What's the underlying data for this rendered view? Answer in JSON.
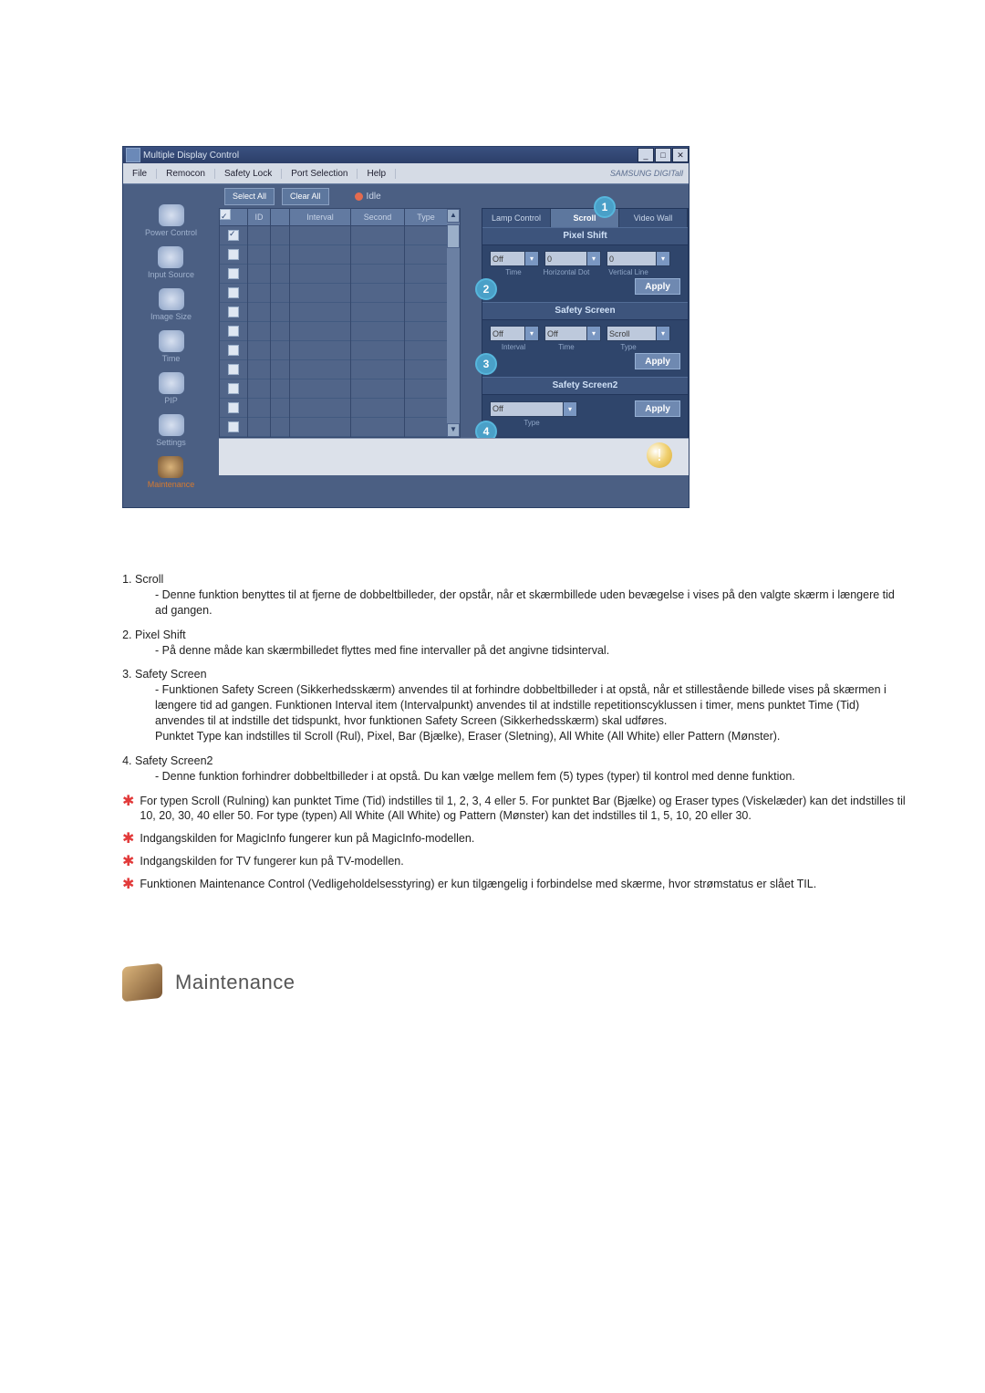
{
  "app": {
    "title": "Multiple Display Control",
    "menu": [
      "File",
      "Remocon",
      "Safety Lock",
      "Port Selection",
      "Help"
    ],
    "brand": "SAMSUNG DIGITall"
  },
  "toolbar": {
    "select_all": "Select All",
    "clear_all": "Clear All",
    "idle": "Idle"
  },
  "sidebar": {
    "items": [
      {
        "label": "Power Control"
      },
      {
        "label": "Input Source"
      },
      {
        "label": "Image Size"
      },
      {
        "label": "Time"
      },
      {
        "label": "PIP"
      },
      {
        "label": "Settings"
      },
      {
        "label": "Maintenance"
      }
    ]
  },
  "table": {
    "headers": {
      "check": "",
      "id": "ID",
      "ico": "",
      "interval": "Interval",
      "second": "Second",
      "type": "Type"
    },
    "rows": 11
  },
  "panel": {
    "tabs": {
      "lamp": "Lamp Control",
      "scroll": "Scroll",
      "video_wall": "Video Wall"
    },
    "labels": {
      "1": "1",
      "2": "2",
      "3": "3",
      "4": "4"
    },
    "pixel_shift": {
      "title": "Pixel Shift",
      "time": {
        "value": "Off",
        "label": "Time"
      },
      "hdot": {
        "value": "0",
        "label": "Horizontal Dot"
      },
      "vline": {
        "value": "0",
        "label": "Vertical Line"
      },
      "apply": "Apply"
    },
    "safety_screen": {
      "title": "Safety Screen",
      "interval": {
        "value": "Off",
        "label": "Interval"
      },
      "time": {
        "value": "Off",
        "label": "Time"
      },
      "type": {
        "value": "Scroll",
        "label": "Type"
      },
      "apply": "Apply"
    },
    "safety_screen2": {
      "title": "Safety Screen2",
      "type": {
        "value": "Off",
        "label": "Type"
      },
      "apply": "Apply"
    }
  },
  "content": {
    "items": [
      {
        "title": "Scroll",
        "body": "- Denne funktion benyttes til at fjerne de dobbeltbilleder, der opstår, når et skærmbillede uden bevægelse i vises på den valgte skærm i længere tid ad gangen."
      },
      {
        "title": "Pixel Shift",
        "body": "- På denne måde kan skærmbilledet flyttes med fine intervaller på det angivne tidsinterval."
      },
      {
        "title": "Safety Screen",
        "body": "- Funktionen Safety Screen (Sikkerhedsskærm) anvendes til at forhindre dobbeltbilleder i at opstå, når et stillestående billede vises på skærmen i længere tid ad gangen.  Funktionen Interval item (Intervalpunkt) anvendes til at indstille repetitionscyklussen i timer, mens punktet Time (Tid) anvendes til at indstille det tidspunkt, hvor funktionen Safety Screen (Sikkerhedsskærm) skal udføres.\nPunktet Type kan indstilles til Scroll (Rul), Pixel, Bar (Bjælke), Eraser (Sletning), All White (All White) eller Pattern (Mønster)."
      },
      {
        "title": "Safety Screen2",
        "body": "- Denne funktion forhindrer dobbeltbilleder i at opstå. Du kan vælge mellem fem (5) types (typer) til kontrol med denne funktion."
      }
    ],
    "stars": [
      "For typen Scroll (Rulning) kan punktet Time (Tid) indstilles til 1, 2, 3, 4 eller 5. For punktet Bar (Bjælke) og Eraser types (Viskelæder) kan det indstilles til 10, 20, 30, 40 eller 50. For type (typen) All White (All White) og Pattern (Mønster) kan det indstilles til 1, 5, 10, 20 eller 30.",
      "Indgangskilden for MagicInfo fungerer kun på MagicInfo-modellen.",
      "Indgangskilden for TV fungerer kun på TV-modellen.",
      "Funktionen Maintenance Control (Vedligeholdelsesstyring) er kun tilgængelig i forbindelse med skærme, hvor strømstatus er slået TIL."
    ]
  },
  "footer": {
    "title": "Maintenance"
  }
}
